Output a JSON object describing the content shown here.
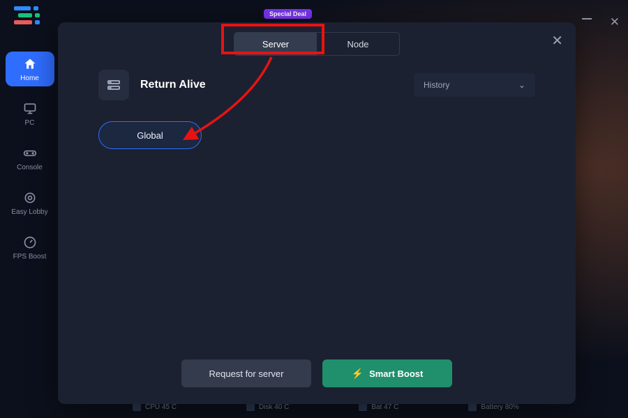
{
  "topbar": {
    "special_deal_label": "Special Deal"
  },
  "window_controls": {
    "minimize": "minimize",
    "close": "close"
  },
  "sidebar": {
    "items": [
      {
        "label": "Home"
      },
      {
        "label": "PC"
      },
      {
        "label": "Console"
      },
      {
        "label": "Easy Lobby"
      },
      {
        "label": "FPS Boost"
      }
    ]
  },
  "modal": {
    "tabs": [
      {
        "label": "Server",
        "active": true
      },
      {
        "label": "Node",
        "active": false
      }
    ],
    "game_title": "Return Alive",
    "history_dropdown": {
      "label": "History"
    },
    "server_options": [
      {
        "label": "Global",
        "selected": true
      }
    ],
    "footer": {
      "request_label": "Request for server",
      "smart_boost_label": "Smart Boost"
    }
  },
  "annotations": {
    "highlight_tab": "Server",
    "arrow_target": "Global"
  },
  "status_bar": {
    "items": [
      {
        "label": "CPU 45 C"
      },
      {
        "label": "Disk 40 C"
      },
      {
        "label": "Bat 47 C"
      },
      {
        "label": "Battery 80%"
      }
    ]
  },
  "colors": {
    "accent_blue": "#2f6dff",
    "accent_green": "#1f8f6c",
    "highlight_red": "#e71313",
    "bg_panel": "#1b2130"
  }
}
